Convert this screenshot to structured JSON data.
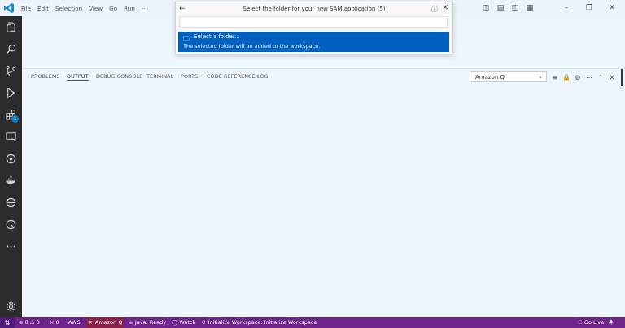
{
  "menu": [
    "File",
    "Edit",
    "Selection",
    "View",
    "Go",
    "Run",
    "···"
  ],
  "quick_pick": {
    "title": "Select the folder for your new SAM application (5)",
    "item_label": "Select a folder...",
    "item_detail": "The selected folder will be added to the workspace."
  },
  "panel": {
    "tabs": [
      "PROBLEMS",
      "OUTPUT",
      "DEBUG CONSOLE",
      "TERMINAL",
      "PORTS",
      "CODE REFERENCE LOG"
    ],
    "active_tab": "OUTPUT",
    "channel": "Amazon Q"
  },
  "activity": {
    "extensions_badge": "1"
  },
  "status": {
    "errors": "0",
    "warnings": "0",
    "ports": "0",
    "aws": "AWS",
    "amazon_q": "Amazon Q",
    "java": "Java: Ready",
    "watch": "Watch",
    "init": "Initialize Workspace: Initialize Workspace",
    "go_live": "Go Live"
  },
  "colors": {
    "statusbar": "#6f248c",
    "activitybar": "#2c2c2c",
    "selection": "#0060c0"
  }
}
